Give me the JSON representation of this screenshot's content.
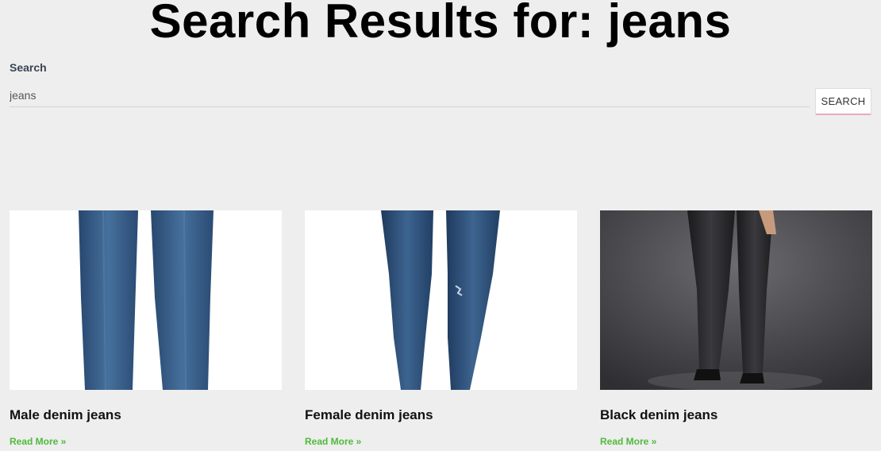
{
  "page": {
    "title": "Search Results for: jeans"
  },
  "search": {
    "label": "Search",
    "value": "jeans",
    "button_label": "SEARCH"
  },
  "results": [
    {
      "title": "Male denim jeans",
      "link_text": "Read More »",
      "image_icon": "male-jeans-image"
    },
    {
      "title": "Female denim jeans",
      "link_text": "Read More »",
      "image_icon": "female-jeans-image"
    },
    {
      "title": "Black denim jeans",
      "link_text": "Read More »",
      "image_icon": "black-jeans-image"
    }
  ],
  "colors": {
    "background": "#eeeeee",
    "link": "#4fba3c",
    "button_accent": "#e7a9bf",
    "denim_blue": "#2f5784",
    "dark_backdrop": "#4a4a4e"
  }
}
